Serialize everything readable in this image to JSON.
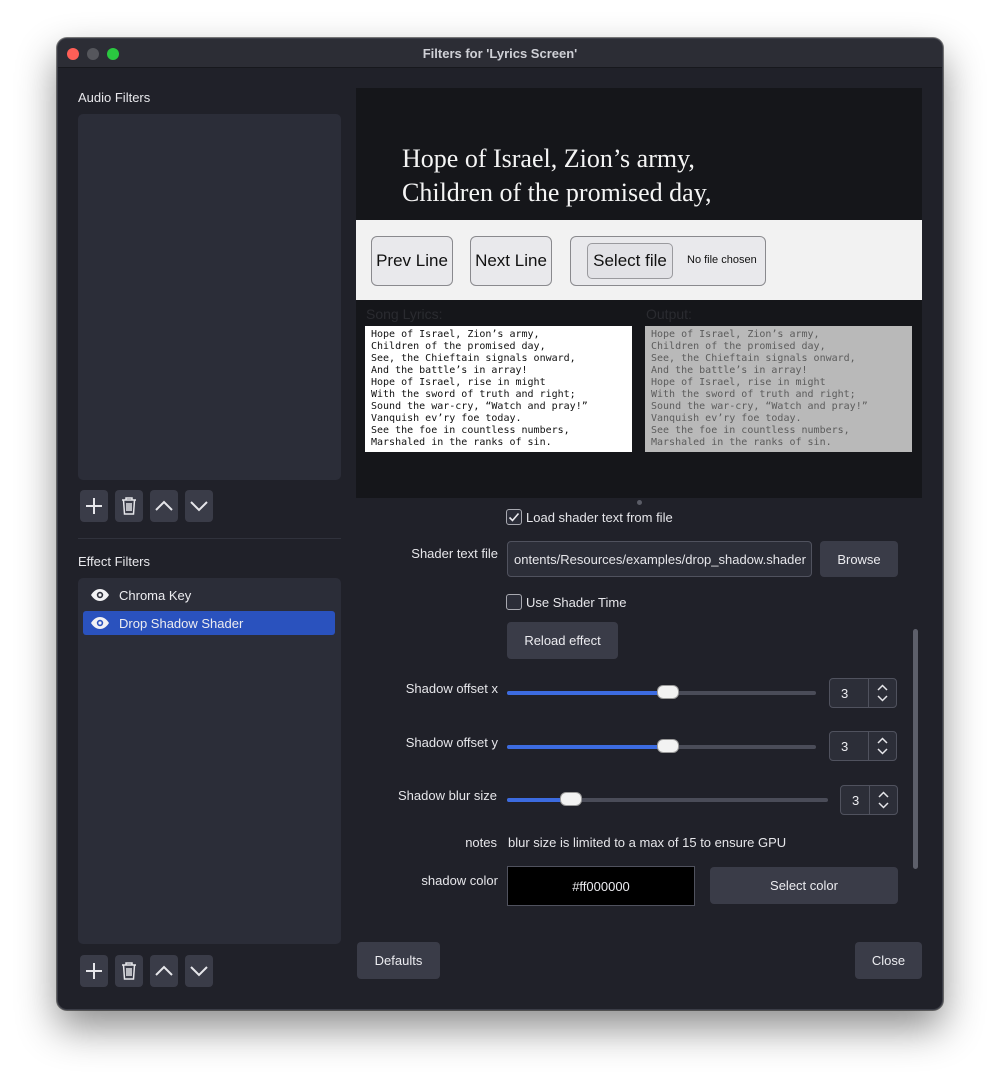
{
  "window": {
    "title": "Filters for 'Lyrics Screen'"
  },
  "audio_filters": {
    "label": "Audio Filters"
  },
  "effect_filters": {
    "label": "Effect Filters",
    "items": [
      {
        "label": "Chroma Key",
        "icon": "eye-icon",
        "selected": false
      },
      {
        "label": "Drop Shadow Shader",
        "icon": "eye-icon",
        "selected": true
      }
    ]
  },
  "toolbar_icons": [
    "plus-icon",
    "trash-icon",
    "chevron-up-icon",
    "chevron-down-icon"
  ],
  "preview": {
    "lyric_lines": [
      "Hope of Israel, Zion’s army,",
      "Children of the promised day,"
    ],
    "prev_button": "Prev Line",
    "next_button": "Next Line",
    "select_file_button": "Select file",
    "file_status": "No file chosen",
    "song_lyrics_label": "Song Lyrics:",
    "output_label": "Output:",
    "song_lyrics_text": "Hope of Israel, Zion’s army,\nChildren of the promised day,\nSee, the Chieftain signals onward,\nAnd the battle’s in array!\nHope of Israel, rise in might\nWith the sword of truth and right;\nSound the war-cry, “Watch and pray!”\nVanquish ev’ry foe today.\nSee the foe in countless numbers,\nMarshaled in the ranks of sin.",
    "output_text": "Hope of Israel, Zion’s army,\nChildren of the promised day,\nSee, the Chieftain signals onward,\nAnd the battle’s in array!\nHope of Israel, rise in might\nWith the sword of truth and right;\nSound the war-cry, “Watch and pray!”\nVanquish ev’ry foe today.\nSee the foe in countless numbers,\nMarshaled in the ranks of sin."
  },
  "properties": {
    "load_from_file": {
      "label": "Load shader text from file",
      "checked": true
    },
    "shader_text_file": {
      "label": "Shader text file",
      "value": "ontents/Resources/examples/drop_shadow.shader",
      "browse": "Browse"
    },
    "use_shader_time": {
      "label": "Use Shader Time",
      "checked": false
    },
    "reload_effect": "Reload effect",
    "shadow_offset_x": {
      "label": "Shadow offset x",
      "value": "3",
      "level": 0.52
    },
    "shadow_offset_y": {
      "label": "Shadow offset y",
      "value": "3",
      "level": 0.52
    },
    "shadow_blur_size": {
      "label": "Shadow blur size",
      "value": "3",
      "level": 0.2
    },
    "notes": {
      "label": "notes",
      "value": "blur size is limited to a max of 15 to ensure GPU"
    },
    "shadow_color": {
      "label": "shadow color",
      "value": "#ff000000",
      "select": "Select color"
    }
  },
  "footer": {
    "defaults": "Defaults",
    "close": "Close"
  },
  "colors": {
    "accent": "#2a52be",
    "slider": "#3c6be0",
    "window_bg": "#202129",
    "panel_bg": "#2b2d38"
  }
}
